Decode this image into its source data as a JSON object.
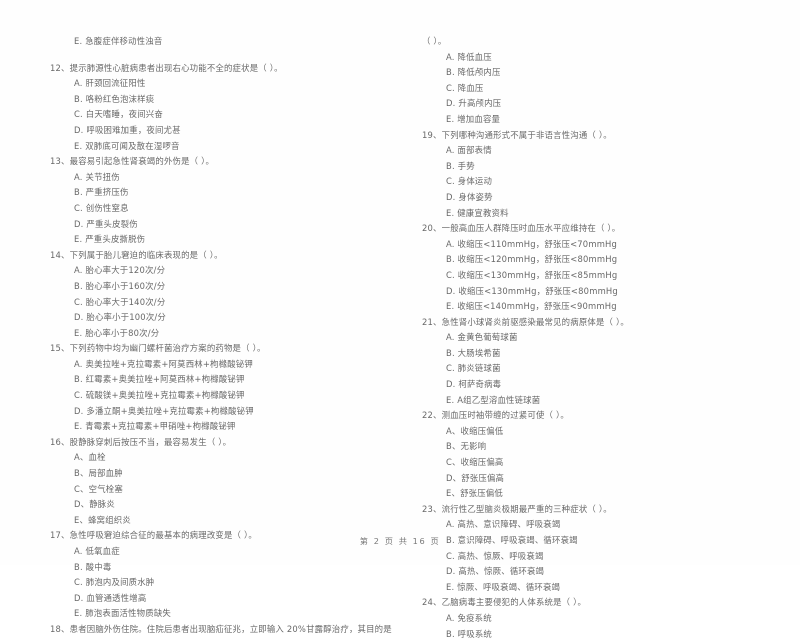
{
  "document": {
    "type": "exam-paper",
    "language": "zh-CN",
    "footer": "第 2 页 共 16 页"
  },
  "left_column": {
    "items": [
      {
        "kind": "option",
        "text": "E. 急腹症伴移动性浊音"
      },
      {
        "kind": "spacer",
        "text": ""
      },
      {
        "kind": "question",
        "text": "12、提示肺源性心脏病患者出现右心功能不全的症状是（      ）。"
      },
      {
        "kind": "option",
        "text": "A.  肝颈回流征阳性"
      },
      {
        "kind": "option",
        "text": "B.  咯粉红色泡沫样痰"
      },
      {
        "kind": "option",
        "text": "C.  白天嗜睡，夜间兴奋"
      },
      {
        "kind": "option",
        "text": "D.  呼吸困难加重，夜间尤甚"
      },
      {
        "kind": "option",
        "text": "E.  双肺底可闻及散在湿啰音"
      },
      {
        "kind": "question",
        "text": "13、最容易引起急性肾衰竭的外伤是（      ）。"
      },
      {
        "kind": "option",
        "text": "A.  关节扭伤"
      },
      {
        "kind": "option",
        "text": "B.  严重挤压伤"
      },
      {
        "kind": "option",
        "text": "C.  创伤性窒息"
      },
      {
        "kind": "option",
        "text": "D.  严重头皮裂伤"
      },
      {
        "kind": "option",
        "text": "E.  严重头皮撕脱伤"
      },
      {
        "kind": "question",
        "text": "14、下列属于胎儿窘迫的临床表现的是（      ）。"
      },
      {
        "kind": "option",
        "text": "A. 胎心率大于120次/分"
      },
      {
        "kind": "option",
        "text": "B. 胎心率小于160次/分"
      },
      {
        "kind": "option",
        "text": "C. 胎心率大于140次/分"
      },
      {
        "kind": "option",
        "text": "D. 胎心率小于100次/分"
      },
      {
        "kind": "option",
        "text": "E. 胎心率小于80次/分"
      },
      {
        "kind": "question",
        "text": "15、下列药物中均为幽门螺杆菌治疗方案的药物是（      ）。"
      },
      {
        "kind": "option",
        "text": "A. 奥美拉唑+克拉霉素+阿莫西林+枸橼酸铋钾"
      },
      {
        "kind": "option",
        "text": "B. 红霉素+奥美拉唑+阿莫西林+枸橼酸铋钾"
      },
      {
        "kind": "option",
        "text": "C. 硫酸镁+奥美拉唑+克拉霉素+枸橼酸铋钾"
      },
      {
        "kind": "option",
        "text": "D. 多潘立酮+奥美拉唑+克拉霉素+枸橼酸铋钾"
      },
      {
        "kind": "option",
        "text": "E. 青霉素+克拉霉素+甲硝唑+枸橼酸铋钾"
      },
      {
        "kind": "question",
        "text": "16、股静脉穿刺后按压不当，最容易发生（      ）。"
      },
      {
        "kind": "option",
        "text": "A、血栓"
      },
      {
        "kind": "option",
        "text": "B、局部血肿"
      },
      {
        "kind": "option",
        "text": "C、空气栓塞"
      },
      {
        "kind": "option",
        "text": "D、静脉炎"
      },
      {
        "kind": "option",
        "text": "E、蜂窝组织炎"
      },
      {
        "kind": "question",
        "text": "17、急性呼吸窘迫综合征的最基本的病理改变是（      ）。"
      },
      {
        "kind": "option",
        "text": "A. 低氧血症"
      },
      {
        "kind": "option",
        "text": "B. 酸中毒"
      },
      {
        "kind": "option",
        "text": "C. 肺泡内及间质水肿"
      },
      {
        "kind": "option",
        "text": "D. 血管通透性增高"
      },
      {
        "kind": "option",
        "text": "E. 肺泡表面活性物质缺失"
      },
      {
        "kind": "question",
        "text": "18、患者因脑外伤住院。住院后患者出现脑疝征兆，立即输入    20%甘露醇治疗，其目的是"
      }
    ]
  },
  "right_column": {
    "items": [
      {
        "kind": "continuation",
        "text": "（      ）。"
      },
      {
        "kind": "option",
        "text": "A.  降低血压"
      },
      {
        "kind": "option",
        "text": "B.  降低颅内压"
      },
      {
        "kind": "option",
        "text": "C.  降血压"
      },
      {
        "kind": "option",
        "text": "D.  升高颅内压"
      },
      {
        "kind": "option",
        "text": "E.  增加血容量"
      },
      {
        "kind": "question",
        "text": "19、下列哪种沟通形式不属于非语言性沟通（      ）。"
      },
      {
        "kind": "option",
        "text": "A.  面部表情"
      },
      {
        "kind": "option",
        "text": "B.  手势"
      },
      {
        "kind": "option",
        "text": "C.  身体运动"
      },
      {
        "kind": "option",
        "text": "D.  身体姿势"
      },
      {
        "kind": "option",
        "text": "E.  健康宣教资料"
      },
      {
        "kind": "question",
        "text": "20、一般高血压人群降压时血压水平应维持在（      ）。"
      },
      {
        "kind": "option",
        "text": "A. 收缩压<110mmHg，舒张压<70mmHg"
      },
      {
        "kind": "option",
        "text": "B. 收缩压<120mmHg，舒张压<80mmHg"
      },
      {
        "kind": "option",
        "text": "C. 收缩压<130mmHg，舒张压<85mmHg"
      },
      {
        "kind": "option",
        "text": "D. 收缩压<130mmHg，舒张压<80mmHg"
      },
      {
        "kind": "option",
        "text": "E. 收缩压<140mmHg，舒张压<90mmHg"
      },
      {
        "kind": "question",
        "text": "21、急性肾小球肾炎前驱感染最常见的病原体是（      ）。"
      },
      {
        "kind": "option",
        "text": "A.  金黄色葡萄球菌"
      },
      {
        "kind": "option",
        "text": "B.  大肠埃希菌"
      },
      {
        "kind": "option",
        "text": "C.  肺炎链球菌"
      },
      {
        "kind": "option",
        "text": "D.  柯萨奇病毒"
      },
      {
        "kind": "option",
        "text": "E.  A组乙型溶血性链球菌"
      },
      {
        "kind": "question",
        "text": "22、测血压时袖带缠的过紧可使（      ）。"
      },
      {
        "kind": "option",
        "text": "A、收缩压偏低"
      },
      {
        "kind": "option",
        "text": "B、无影响"
      },
      {
        "kind": "option",
        "text": "C、收缩压偏高"
      },
      {
        "kind": "option",
        "text": "D、舒张压偏高"
      },
      {
        "kind": "option",
        "text": "E、舒张压偏低"
      },
      {
        "kind": "question",
        "text": "23、流行性乙型脑炎极期最严重的三种症状（      ）。"
      },
      {
        "kind": "option",
        "text": "A. 高热、意识障碍、呼吸衰竭"
      },
      {
        "kind": "option",
        "text": "B. 意识障碍、呼吸衰竭、循环衰竭"
      },
      {
        "kind": "option",
        "text": "C. 高热、惊厥、呼吸衰竭"
      },
      {
        "kind": "option",
        "text": "D. 高热、惊厥、循环衰竭"
      },
      {
        "kind": "option",
        "text": "E. 惊厥、呼吸衰竭、循环衰竭"
      },
      {
        "kind": "question",
        "text": "24、乙脑病毒主要侵犯的人体系统是（      ）。"
      },
      {
        "kind": "option",
        "text": "A. 免疫系统"
      },
      {
        "kind": "option",
        "text": "B. 呼吸系统"
      }
    ]
  }
}
